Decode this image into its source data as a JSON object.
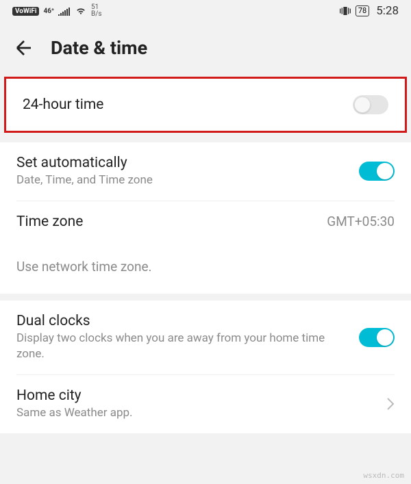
{
  "status": {
    "vowifi": "VoWiFi",
    "network": "46⁺",
    "speed_num": "51",
    "speed_unit": "B/s",
    "battery": "78",
    "clock": "5:28"
  },
  "header": {
    "title": "Date & time"
  },
  "rows": {
    "twenty_four": {
      "title": "24-hour time"
    },
    "auto": {
      "title": "Set automatically",
      "sub": "Date, Time, and Time zone"
    },
    "zone": {
      "title": "Time zone",
      "value": "GMT+05:30"
    },
    "hint": "Use network time zone.",
    "dual": {
      "title": "Dual clocks",
      "sub": "Display two clocks when you are away from your home time zone."
    },
    "home": {
      "title": "Home city",
      "sub": "Same as Weather app."
    }
  },
  "watermark": "wsxdn.com"
}
